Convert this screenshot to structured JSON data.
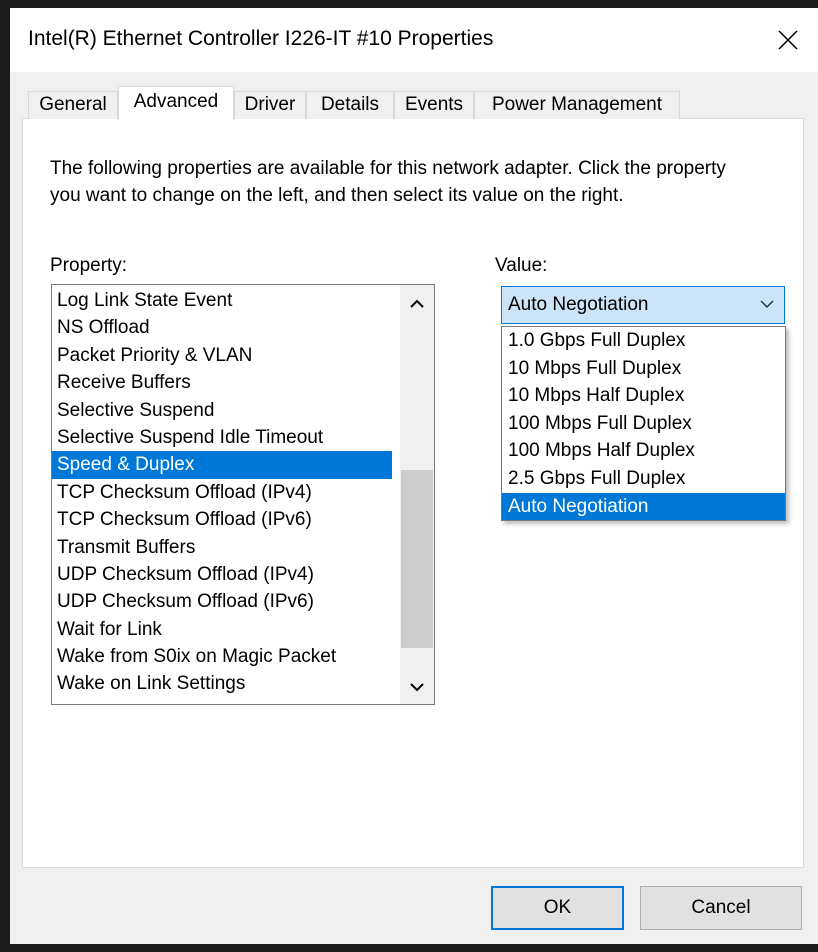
{
  "window": {
    "title": "Intel(R) Ethernet Controller I226-IT #10 Properties"
  },
  "tabs": [
    {
      "label": "General"
    },
    {
      "label": "Advanced"
    },
    {
      "label": "Driver"
    },
    {
      "label": "Details"
    },
    {
      "label": "Events"
    },
    {
      "label": "Power Management"
    }
  ],
  "active_tab": "Advanced",
  "description": "The following properties are available for this network adapter. Click the property you want to change on the left, and then select its value on the right.",
  "property_label": "Property:",
  "value_label": "Value:",
  "properties": [
    "Log Link State Event",
    "NS Offload",
    "Packet Priority & VLAN",
    "Receive Buffers",
    "Selective Suspend",
    "Selective Suspend Idle Timeout",
    "Speed & Duplex",
    "TCP Checksum Offload (IPv4)",
    "TCP Checksum Offload (IPv6)",
    "Transmit Buffers",
    "UDP Checksum Offload (IPv4)",
    "UDP Checksum Offload (IPv6)",
    "Wait for Link",
    "Wake from S0ix on Magic Packet",
    "Wake on Link Settings"
  ],
  "selected_property": "Speed & Duplex",
  "value_combo": {
    "selected": "Auto Negotiation",
    "options": [
      "1.0 Gbps Full Duplex",
      "10 Mbps Full Duplex",
      "10 Mbps Half Duplex",
      "100 Mbps Full Duplex",
      "100 Mbps Half Duplex",
      "2.5 Gbps Full Duplex",
      "Auto Negotiation"
    ]
  },
  "buttons": {
    "ok": "OK",
    "cancel": "Cancel"
  },
  "colors": {
    "selection": "#0078d7",
    "combo_bg": "#cce4f7",
    "dialog_bg": "#f0f0f0"
  },
  "icons": {
    "close": "close-icon",
    "scroll_up": "chevron-up-icon",
    "scroll_down": "chevron-down-icon",
    "combo": "chevron-down-icon"
  }
}
